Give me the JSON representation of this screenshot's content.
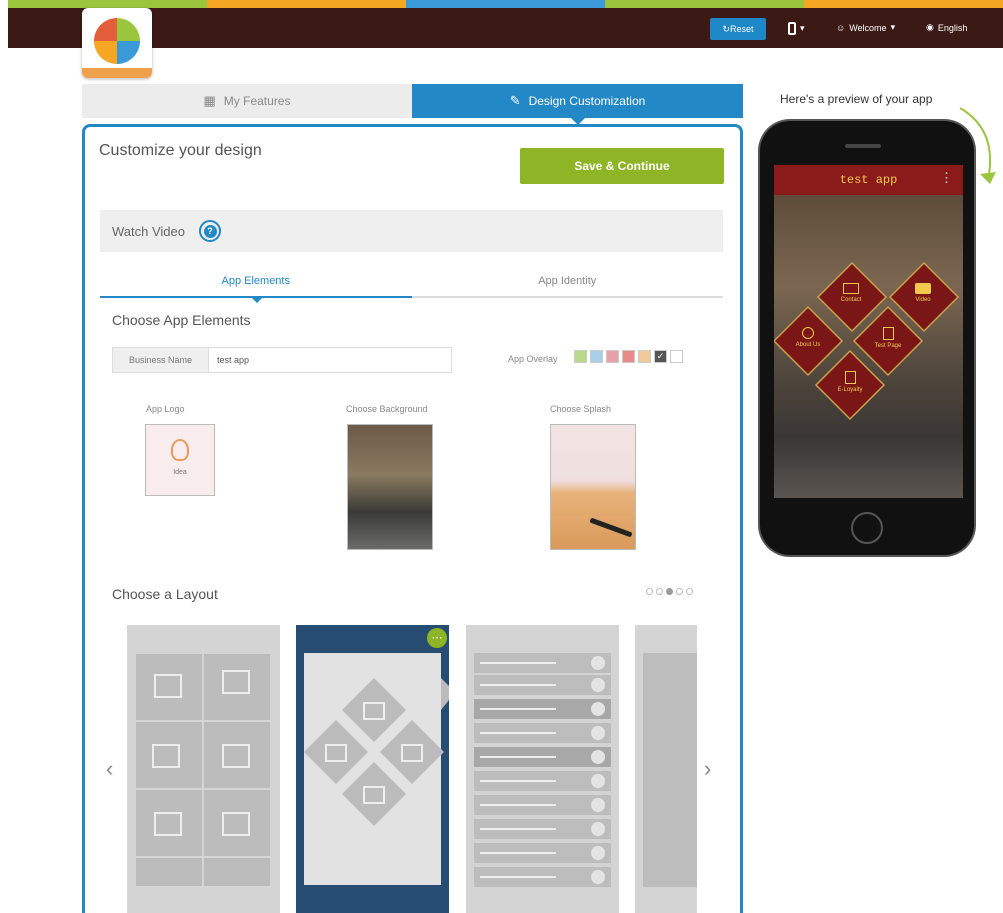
{
  "topbar": {
    "reset_label": "Reset",
    "welcome_label": "Welcome",
    "language_label": "English"
  },
  "tabs": {
    "my_features": "My Features",
    "design_customization": "Design Customization"
  },
  "main": {
    "heading": "Customize your design",
    "save_label": "Save & Continue",
    "watch_video": "Watch Video",
    "subtabs": [
      "App Elements",
      "App Identity"
    ],
    "choose_elements": "Choose App Elements",
    "business_name_label": "Business Name",
    "business_name_value": "test app",
    "overlay_label": "App Overlay",
    "overlay_colors": [
      "#b8d98a",
      "#a7cfe8",
      "#e8a0a8",
      "#e88a8a",
      "#f0c89a",
      "#555555",
      "#ffffff"
    ],
    "app_logo_label": "App Logo",
    "choose_background_label": "Choose Background",
    "choose_splash_label": "Choose Splash",
    "logo_badge": "Idea",
    "choose_layout": "Choose a Layout"
  },
  "preview": {
    "label": "Here's a preview of your app",
    "app_title": "test app",
    "menu_items": [
      "Contact",
      "Video",
      "About Us",
      "Test Page",
      "E-Loyalty"
    ]
  },
  "colors": {
    "accent": "#2288c6",
    "save": "#8db525",
    "topbar": "#3b1a16",
    "app_bar": "#8b1a1a",
    "diamond": "#7a1616"
  }
}
